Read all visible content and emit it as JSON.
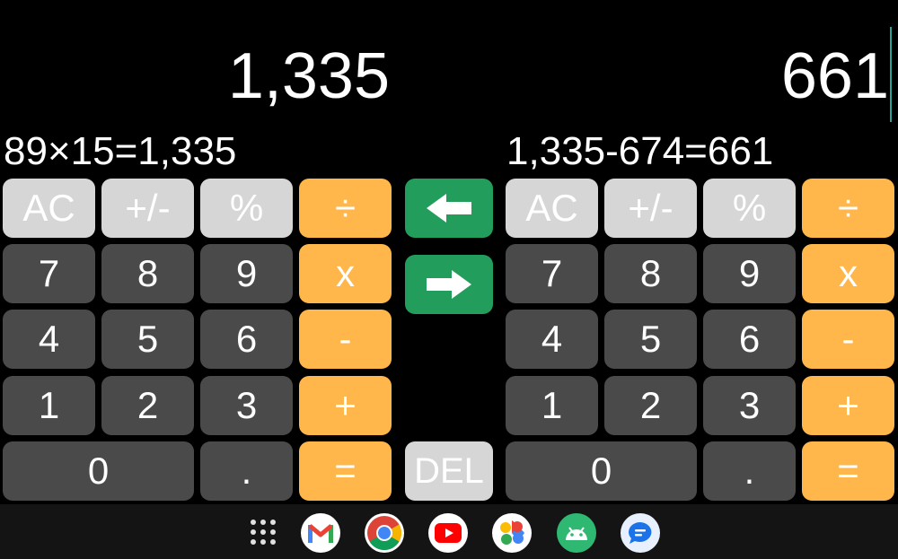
{
  "left": {
    "result": "1,335",
    "expression": "89×15=1,335",
    "rows": [
      [
        {
          "label": "AC",
          "kind": "fn"
        },
        {
          "label": "+/-",
          "kind": "fn"
        },
        {
          "label": "%",
          "kind": "fn"
        },
        {
          "label": "÷",
          "kind": "op"
        }
      ],
      [
        {
          "label": "7",
          "kind": "num"
        },
        {
          "label": "8",
          "kind": "num"
        },
        {
          "label": "9",
          "kind": "num"
        },
        {
          "label": "x",
          "kind": "op"
        }
      ],
      [
        {
          "label": "4",
          "kind": "num"
        },
        {
          "label": "5",
          "kind": "num"
        },
        {
          "label": "6",
          "kind": "num"
        },
        {
          "label": "-",
          "kind": "op"
        }
      ],
      [
        {
          "label": "1",
          "kind": "num"
        },
        {
          "label": "2",
          "kind": "num"
        },
        {
          "label": "3",
          "kind": "num"
        },
        {
          "label": "+",
          "kind": "op"
        }
      ],
      [
        {
          "label": "0",
          "kind": "num"
        },
        {
          "label": ".",
          "kind": "num"
        },
        {
          "label": "=",
          "kind": "op"
        }
      ]
    ]
  },
  "right": {
    "result": "661",
    "expression": "1,335-674=661",
    "rows": [
      [
        {
          "label": "AC",
          "kind": "fn"
        },
        {
          "label": "+/-",
          "kind": "fn"
        },
        {
          "label": "%",
          "kind": "fn"
        },
        {
          "label": "÷",
          "kind": "op"
        }
      ],
      [
        {
          "label": "7",
          "kind": "num"
        },
        {
          "label": "8",
          "kind": "num"
        },
        {
          "label": "9",
          "kind": "num"
        },
        {
          "label": "x",
          "kind": "op"
        }
      ],
      [
        {
          "label": "4",
          "kind": "num"
        },
        {
          "label": "5",
          "kind": "num"
        },
        {
          "label": "6",
          "kind": "num"
        },
        {
          "label": "-",
          "kind": "op"
        }
      ],
      [
        {
          "label": "1",
          "kind": "num"
        },
        {
          "label": "2",
          "kind": "num"
        },
        {
          "label": "3",
          "kind": "num"
        },
        {
          "label": "+",
          "kind": "op"
        }
      ],
      [
        {
          "label": "0",
          "kind": "num"
        },
        {
          "label": ".",
          "kind": "num"
        },
        {
          "label": "=",
          "kind": "op"
        }
      ]
    ]
  },
  "middle": {
    "arrow_left_icon": "arrow-left-icon",
    "arrow_right_icon": "arrow-right-icon",
    "del_label": "DEL"
  },
  "taskbar": {
    "apps": [
      "app-drawer-icon",
      "gmail-icon",
      "chrome-icon",
      "youtube-icon",
      "photos-icon",
      "android-icon",
      "messages-icon"
    ]
  },
  "colors": {
    "background": "#000000",
    "function_key": "#d6d6d6",
    "number_key": "#4a4a4a",
    "operator_key": "#ffb64a",
    "swap_key": "#239d5c",
    "caret": "#2aa39a"
  }
}
